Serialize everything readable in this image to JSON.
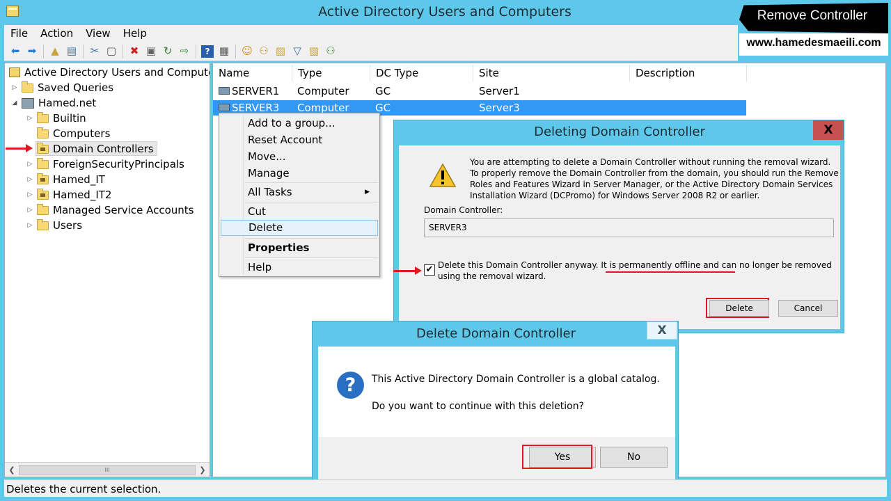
{
  "window": {
    "title": "Active Directory Users and Computers"
  },
  "menu": [
    {
      "label": "File"
    },
    {
      "label": "Action"
    },
    {
      "label": "View"
    },
    {
      "label": "Help"
    }
  ],
  "toolbar": {
    "icons": [
      "back-icon",
      "forward-icon",
      "up-folder-icon",
      "show-tree-icon",
      "cut-icon",
      "copy-icon",
      "delete-icon",
      "properties-icon",
      "refresh-icon",
      "export-icon",
      "help-icon",
      "console-icon",
      "new-user-icon",
      "new-group-icon",
      "new-ou-icon",
      "filter-icon",
      "find-icon",
      "add-to-group-icon"
    ]
  },
  "tree": {
    "root": "Active Directory Users and Computers",
    "saved_queries": "Saved Queries",
    "domain": "Hamed.net",
    "items": [
      {
        "label": "Builtin"
      },
      {
        "label": "Computers"
      },
      {
        "label": "Domain Controllers"
      },
      {
        "label": "ForeignSecurityPrincipals"
      },
      {
        "label": "Hamed_IT"
      },
      {
        "label": "Hamed_IT2"
      },
      {
        "label": "Managed Service Accounts"
      },
      {
        "label": "Users"
      }
    ],
    "scroll_thumb": "III"
  },
  "list": {
    "columns": [
      {
        "label": "Name"
      },
      {
        "label": "Type"
      },
      {
        "label": "DC Type"
      },
      {
        "label": "Site"
      },
      {
        "label": "Description"
      }
    ],
    "rows": [
      {
        "name": "SERVER1",
        "type": "Computer",
        "dc_type": "GC",
        "site": "Server1"
      },
      {
        "name": "SERVER3",
        "type": "Computer",
        "dc_type": "GC",
        "site": "Server3"
      }
    ]
  },
  "context_menu": {
    "add_to_group": "Add to a group...",
    "reset_account": "Reset Account",
    "move": "Move...",
    "manage": "Manage",
    "all_tasks": "All Tasks",
    "cut": "Cut",
    "delete": "Delete",
    "properties": "Properties",
    "help": "Help"
  },
  "dialog1": {
    "title": "Deleting Domain Controller",
    "close": "X",
    "message": "You are attempting to delete a Domain Controller without running the removal wizard. To properly remove the Domain Controller from the domain, you should run the Remove Roles and Features Wizard in Server Manager, or the Active Directory Domain Services Installation Wizard (DCPromo) for Windows Server 2008 R2 or earlier.",
    "dc_label": "Domain Controller:",
    "dc_value": "SERVER3",
    "checkbox_mark": "✔",
    "checkbox_label": "Delete this Domain Controller anyway. It is permanently offline and can no longer be removed using the removal wizard.",
    "delete_button": "Delete",
    "cancel_button": "Cancel"
  },
  "dialog2": {
    "title": "Delete Domain Controller",
    "close": "X",
    "icon": "?",
    "message1": "This Active Directory Domain Controller is a global catalog.",
    "message2": "Do you want to continue with this deletion?",
    "yes_button": "Yes",
    "no_button": "No"
  },
  "status": {
    "text": "Deletes the current selection."
  },
  "watermark": {
    "banner": "Remove Controller",
    "site": "www.hamedesmaeili.com"
  },
  "colors": {
    "frame": "#5ec8ea",
    "selection": "#3398f3",
    "highlight_red": "#e0191e"
  }
}
